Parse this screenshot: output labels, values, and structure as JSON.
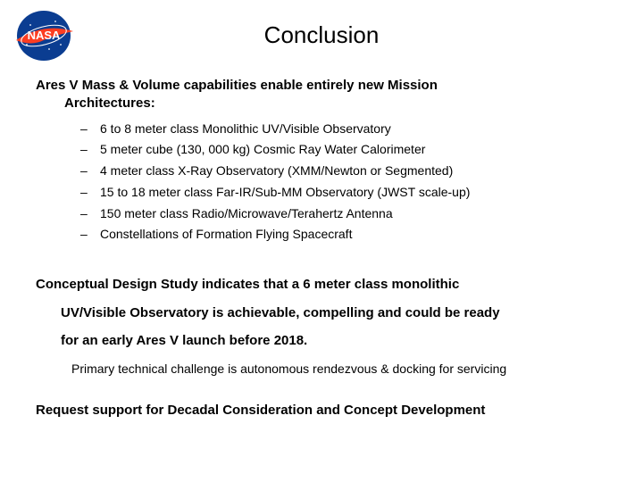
{
  "logo": {
    "name": "nasa-logo"
  },
  "title": "Conclusion",
  "section1": {
    "line1": "Ares V Mass & Volume capabilities enable entirely new Mission",
    "line2": "Architectures:",
    "bullets": [
      "6 to 8 meter class Monolithic UV/Visible Observatory",
      "5 meter cube (130, 000 kg) Cosmic Ray Water Calorimeter",
      "4 meter class X-Ray Observatory (XMM/Newton or Segmented)",
      "15 to 18 meter class Far-IR/Sub-MM Observatory (JWST scale-up)",
      "150 meter class Radio/Microwave/Terahertz Antenna",
      "Constellations of Formation Flying Spacecraft"
    ]
  },
  "section2": {
    "line1": "Conceptual Design Study indicates that a 6 meter class monolithic",
    "line2": "UV/Visible Observatory is achievable, compelling and could be ready",
    "line3": "for an early Ares V launch before 2018.",
    "sub": "Primary technical challenge is autonomous rendezvous & docking for servicing"
  },
  "section3": {
    "text": "Request support for Decadal Consideration and Concept Development"
  }
}
